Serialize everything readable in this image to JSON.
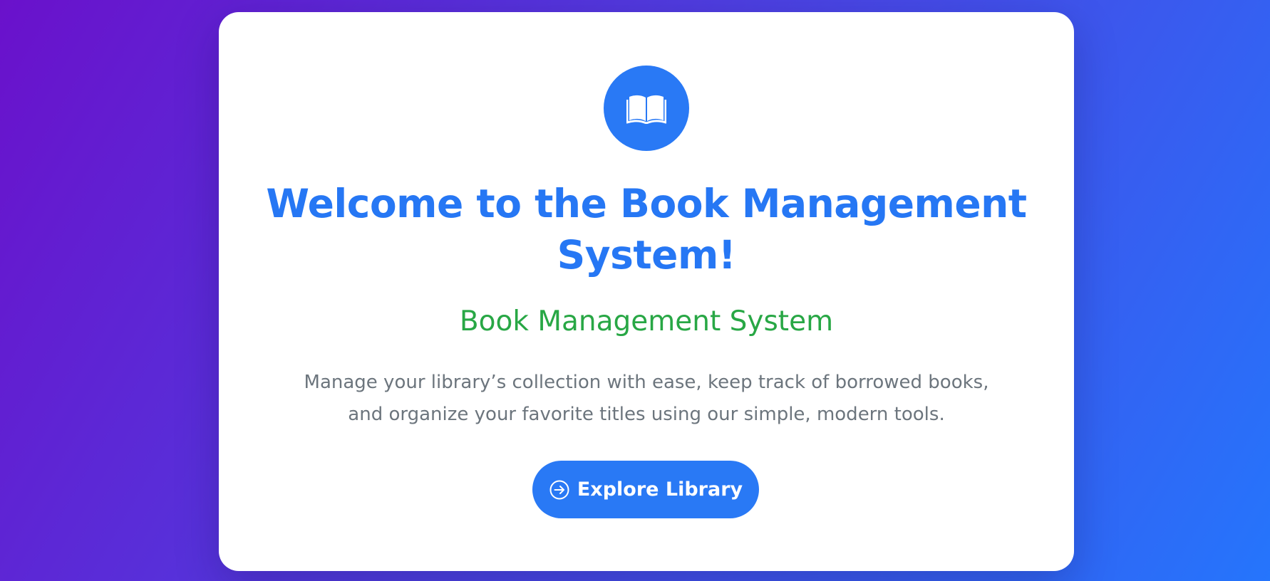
{
  "hero": {
    "logo_icon": "open-book-icon",
    "title": "Welcome to the Book Management System!",
    "subtitle": "Book Management System",
    "description": "Manage your library’s collection with ease, keep track of borrowed books, and organize your favorite titles using our simple, modern tools.",
    "cta": {
      "label": "Explore Library",
      "icon": "arrow-right-circle-icon"
    }
  },
  "colors": {
    "primary": "#2979f5",
    "title": "#2677f4",
    "subtitle": "#28a745",
    "body_text": "#6c757d",
    "background_start": "#6a11cb",
    "background_end": "#2575fc",
    "card": "#ffffff"
  }
}
